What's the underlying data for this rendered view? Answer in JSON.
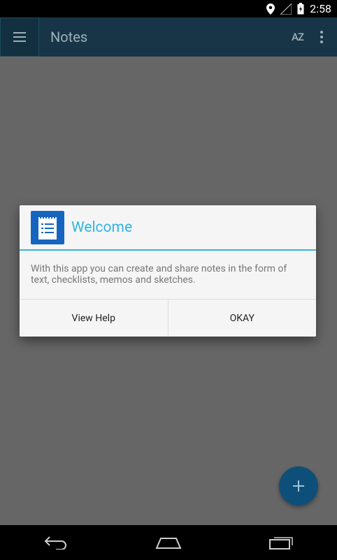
{
  "status_bar": {
    "time": "2:58",
    "icons": [
      "location-icon",
      "signal-icon",
      "battery-charging-icon"
    ]
  },
  "app_bar": {
    "title": "Notes",
    "menu_icon": "hamburger-menu-icon",
    "sort_label": "AZ",
    "overflow_icon": "overflow-menu-icon"
  },
  "dialog": {
    "title": "Welcome",
    "app_icon": "notes-app-icon",
    "body": "With this app you can create and share notes in the form of text, checklists, memos and sketches.",
    "buttons": {
      "view_help": "View Help",
      "okay": "OKAY"
    }
  },
  "fab": {
    "icon": "plus-icon"
  },
  "nav_bar": {
    "icons": [
      "back-icon",
      "home-icon",
      "recents-icon"
    ]
  },
  "colors": {
    "app_bar": "#173547",
    "accent": "#2eb6e6",
    "scrim": "#666666",
    "fab": "#0d4f78",
    "dialog_bg": "#f5f5f5"
  }
}
